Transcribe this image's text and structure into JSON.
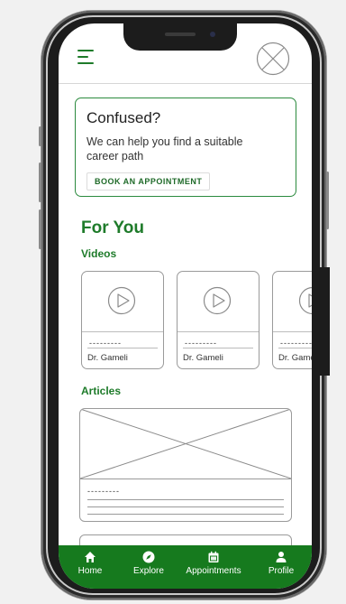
{
  "header": {
    "menu_icon": "hamburger-menu-icon",
    "avatar_icon": "image-placeholder-icon"
  },
  "card": {
    "title": "Confused?",
    "text": "We can help you find a suitable career path",
    "button_label": "BOOK AN APPOINTMENT"
  },
  "for_you": {
    "heading": "For You",
    "videos_heading": "Videos",
    "videos": [
      {
        "title_placeholder": "---------",
        "author": "Dr. Gameli"
      },
      {
        "title_placeholder": "---------",
        "author": "Dr. Gameli"
      },
      {
        "title_placeholder": "---------",
        "author": "Dr. Gameli"
      }
    ],
    "articles_heading": "Articles",
    "articles": [
      {
        "title_placeholder": "---------"
      }
    ]
  },
  "bottom_nav": {
    "items": [
      {
        "label": "Home",
        "icon": "home-icon"
      },
      {
        "label": "Explore",
        "icon": "compass-icon"
      },
      {
        "label": "Appointments",
        "icon": "calendar-icon"
      },
      {
        "label": "Profile",
        "icon": "user-icon"
      }
    ]
  },
  "colors": {
    "accent": "#1e7b2a",
    "nav_background": "#167a1e",
    "card_border": "#2b8a3e"
  }
}
